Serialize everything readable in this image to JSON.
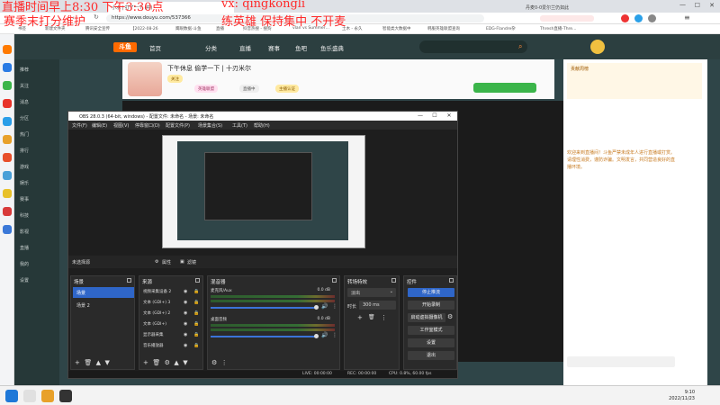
{
  "overlay": {
    "line1": "直播时间早上8:30 下午3:30点",
    "line2": "赛季末打分维护",
    "line3": "vx: qingkongli",
    "line4": "练英雄 保持集中 不开麦"
  },
  "browser": {
    "tabs": [
      "小水 | 打了一个 (中)",
      "丹麦0-0爱尔兰仍如此",
      "…"
    ],
    "url": "https://www.douyu.com/537366",
    "bookmarks": [
      "书签",
      "新建文件夹",
      "腾讯安全宣传",
      "【2022-08-26",
      "鹰眼数据-斗鱼",
      "直播",
      "抖音热搜 - 搜狗",
      "vlan vs Summer…",
      "土木 - 永久",
      "智能类大数据中",
      "韩服英雄联盟查询",
      "EDG-Flandre杂",
      "Thresh直播-Thre…"
    ],
    "right_tab": "丹麦0-0爱尔兰仍如此"
  },
  "douyu": {
    "nav": [
      "首页",
      "分类",
      "直播",
      "赛事",
      "鱼吧",
      "鱼乐盛典"
    ],
    "sidenav": [
      "推荐",
      "关注",
      "消息",
      "分区",
      "热门",
      "排行",
      "游戏",
      "娱乐",
      "赛事",
      "科技",
      "影视",
      "直播",
      "我的",
      "设置"
    ],
    "room_title": "下午休息 偷学一下 | 十刃米尔",
    "tags": [
      "关注",
      "英雄联盟",
      "直播中",
      "主播认证"
    ],
    "chat_text": "欢迎来到直播间！斗鱼严禁未成年人进行直播或打赏。请理性消费，谨防诈骗。文明发言，共同营造良好的直播环境。",
    "rank_label": "贡献周榜"
  },
  "obs": {
    "title": "OBS 28.0.3 (64-bit, windows) - 配置文件: 未命名 - 场景: 未命名",
    "menu": [
      "文件(F)",
      "编辑(E)",
      "视图(V)",
      "停靠窗口(D)",
      "配置文件(P)",
      "场景集合(S)",
      "工具(T)",
      "帮助(H)"
    ],
    "source_bar_label": "未选择源",
    "source_bar_props": "属性",
    "source_bar_filters": "滤镜",
    "docks": {
      "scenes": "场景",
      "sources": "来源",
      "mixer": "混音器",
      "transitions": "转场特效",
      "controls": "控件"
    },
    "scene_list": [
      "场景",
      "场景 2"
    ],
    "source_list": [
      "视频采集设备 2",
      "文本 (GDI+) 3",
      "文本 (GDI+) 2",
      "文本 (GDI+)",
      "显示器采集",
      "音乐播放器"
    ],
    "mixer": [
      {
        "label": "麦克风/Aux",
        "db": "0.0 dB"
      },
      {
        "label": "桌面音频",
        "db": "0.0 dB"
      }
    ],
    "transition": {
      "type": "淡出",
      "duration_label": "时长",
      "duration": "300 ms"
    },
    "controls": [
      "停止推流",
      "开始录制",
      "启动虚拟摄像机",
      "工作室模式",
      "设置",
      "退出"
    ],
    "status": {
      "live": "LIVE: 00:00:00",
      "rec": "REC: 00:00:00",
      "cpu": "CPU: 0.8%, 60.00 fps"
    }
  },
  "taskbar": {
    "time": "9:10",
    "date": "2022/11/23"
  },
  "colors": {
    "accent": "#2f66c8",
    "overlay": "#ff2a2a",
    "douyu_orange": "#ff6a00"
  }
}
